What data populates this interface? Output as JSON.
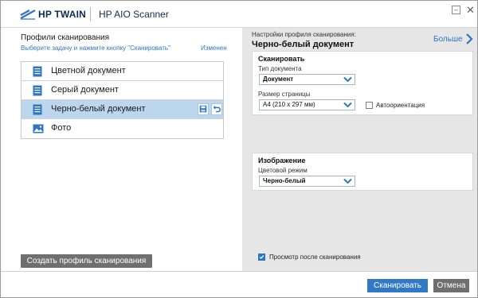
{
  "window": {
    "brand": "HP TWAIN",
    "app_title": "HP AIO Scanner",
    "minimize_glyph": "–",
    "close_glyph": "✕"
  },
  "left_panel": {
    "title": "Профили сканирования",
    "hint": "Выберите задачу и нажмите кнопку \"Сканировать\"",
    "changed_label": "Изменен",
    "profiles": [
      {
        "label": "Цветной документ",
        "icon": "document-icon",
        "selected": false
      },
      {
        "label": "Серый документ",
        "icon": "document-icon",
        "selected": false
      },
      {
        "label": "Черно-белый документ",
        "icon": "document-icon",
        "selected": true
      },
      {
        "label": "Фото",
        "icon": "photo-icon",
        "selected": false
      }
    ],
    "create_button": "Создать профиль сканирования"
  },
  "right_panel": {
    "caption": "Настройки профиля сканирования:",
    "profile_title": "Черно-белый документ",
    "more_label": "Больше",
    "scan_section": {
      "heading": "Сканировать",
      "doc_type_label": "Тип документа",
      "doc_type_value": "Документ",
      "page_size_label": "Размер страницы",
      "page_size_value": "A4 (210 x 297 мм)",
      "auto_orient_label": "Автоориентация",
      "auto_orient_checked": false
    },
    "image_section": {
      "heading": "Изображение",
      "color_mode_label": "Цветовой режим",
      "color_mode_value": "Черно-белый"
    },
    "preview_label": "Просмотр после сканирования",
    "preview_checked": true
  },
  "footer": {
    "scan_button": "Сканировать",
    "cancel_button": "Отмена"
  },
  "colors": {
    "accent": "#2f79c6",
    "selected_row": "#bcd6ee",
    "panel_bg": "#e6e6e6",
    "gray_button": "#6f6f6f"
  }
}
